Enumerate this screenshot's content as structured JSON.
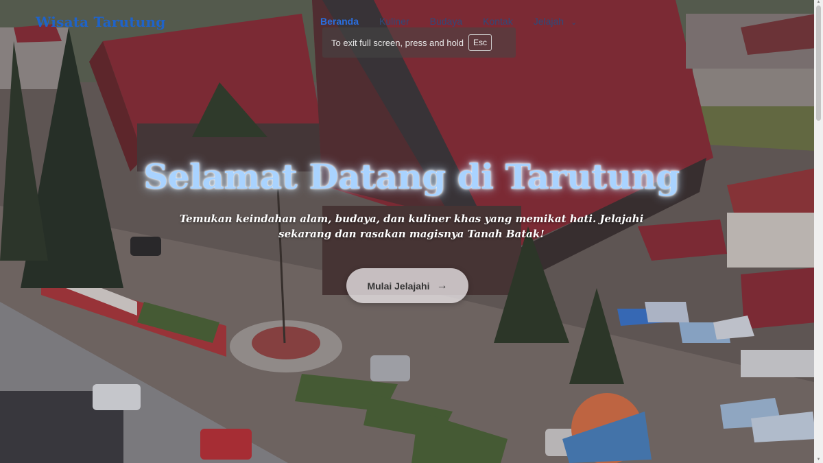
{
  "navbar": {
    "brand": "Wisata Tarutung",
    "items": [
      {
        "label": "Beranda",
        "active": true
      },
      {
        "label": "Kuliner",
        "active": false
      },
      {
        "label": "Budaya",
        "active": false
      },
      {
        "label": "Kontak",
        "active": false
      },
      {
        "label": "Jelajah",
        "active": false,
        "dropdown": true
      }
    ],
    "dropdown_icon": "chevron-down-icon"
  },
  "fullscreen_toast": {
    "message": "To exit full screen, press and hold",
    "key": "Esc"
  },
  "hero": {
    "title": "Selamat Datang di Tarutung",
    "subtitle_line1": "Temukan keindahan alam, budaya, dan kuliner khas yang memikat hati. Jelajahi",
    "subtitle_line2": "sekarang dan rasakan magisnya Tanah Batak!",
    "cta_label": "Mulai Jelajahi",
    "cta_icon": "arrow-right-icon"
  },
  "colors": {
    "brand": "#1f63c9",
    "nav_active": "#2a6fe0",
    "title": "#a9d3ff",
    "roof": "#8e2f3a"
  }
}
